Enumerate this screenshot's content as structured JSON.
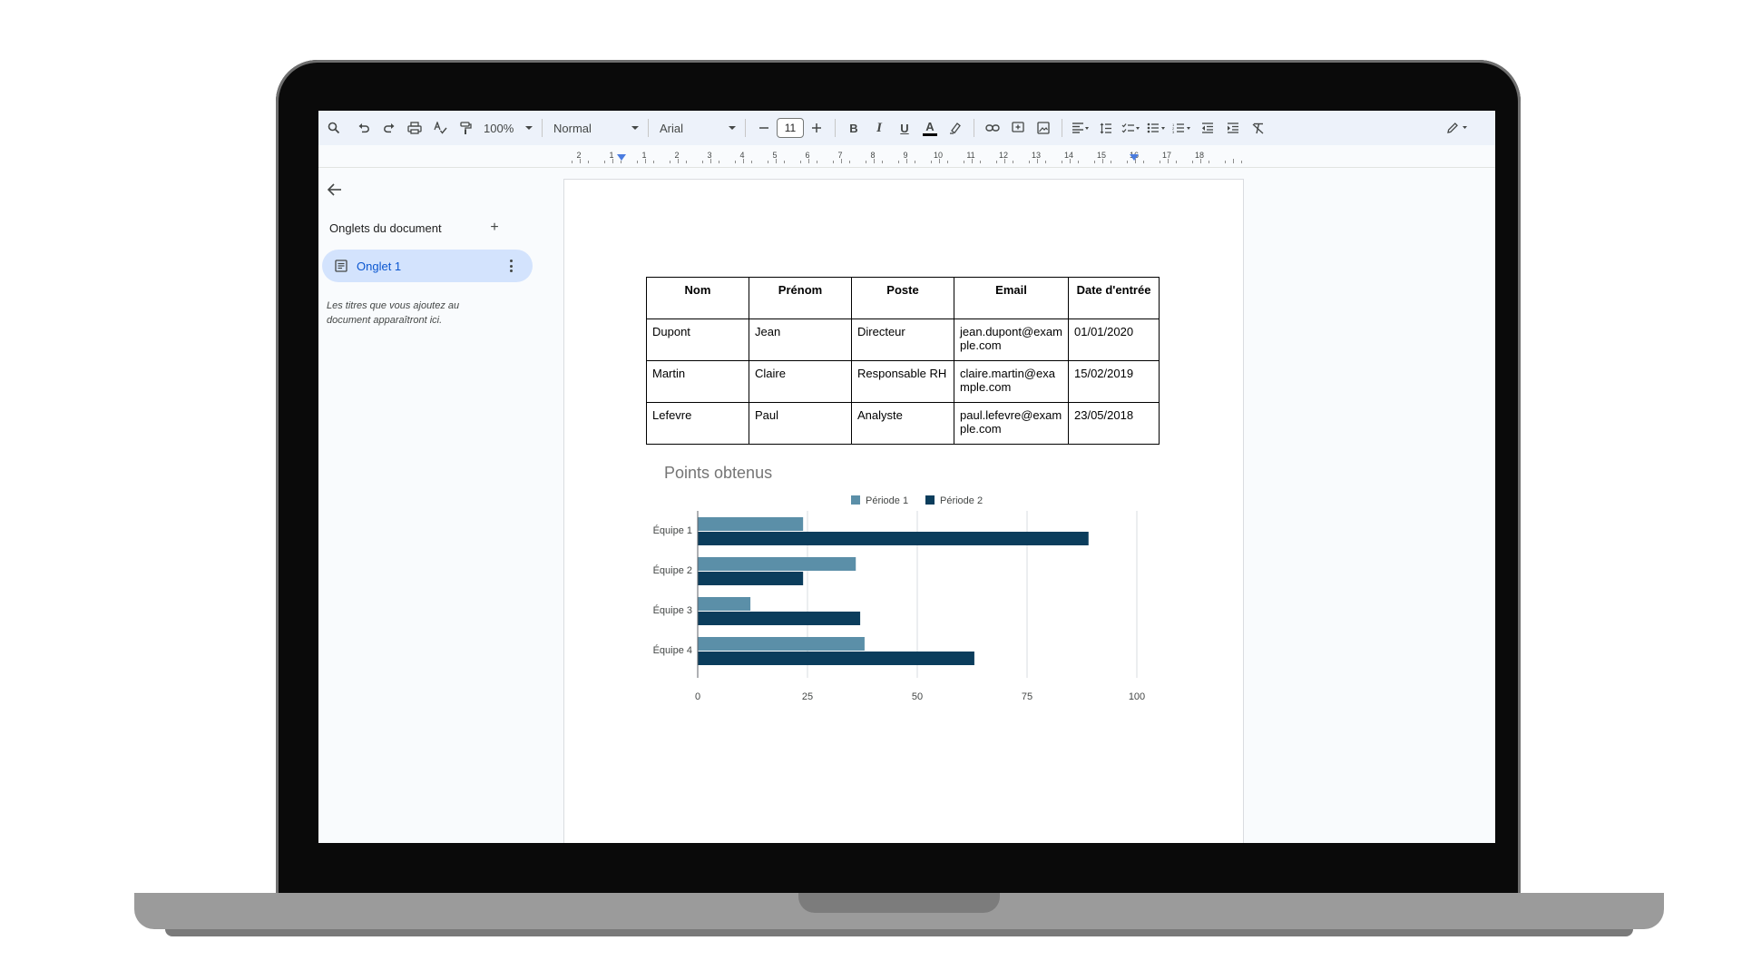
{
  "toolbar": {
    "zoom": "100%",
    "style": "Normal",
    "font": "Arial",
    "font_size": "11",
    "bold": "B",
    "italic": "I",
    "underline": "U",
    "text_color": "A"
  },
  "ruler": {
    "numbers": [
      "2",
      "1",
      "1",
      "2",
      "3",
      "4",
      "5",
      "6",
      "7",
      "8",
      "9",
      "10",
      "11",
      "12",
      "13",
      "14",
      "15",
      "16",
      "17",
      "18"
    ]
  },
  "sidebar": {
    "section_title": "Onglets du document",
    "tab_label": "Onglet 1",
    "hint": "Les titres que vous ajoutez au document apparaîtront ici."
  },
  "table": {
    "headers": [
      "Nom",
      "Prénom",
      "Poste",
      "Email",
      "Date d'entrée"
    ],
    "rows": [
      [
        "Dupont",
        "Jean",
        "Directeur",
        "jean.dupont@example.com",
        "01/01/2020"
      ],
      [
        "Martin",
        "Claire",
        "Responsable RH",
        "claire.martin@example.com",
        "15/02/2019"
      ],
      [
        "Lefevre",
        "Paul",
        "Analyste",
        "paul.lefevre@example.com",
        "23/05/2018"
      ]
    ]
  },
  "chart_data": {
    "type": "bar",
    "orientation": "horizontal",
    "title": "Points obtenus",
    "categories": [
      "Équipe 1",
      "Équipe 2",
      "Équipe 3",
      "Équipe 4"
    ],
    "series": [
      {
        "name": "Période 1",
        "values": [
          24,
          36,
          12,
          38
        ],
        "color": "#5b8fa8"
      },
      {
        "name": "Période 2",
        "values": [
          89,
          24,
          37,
          63
        ],
        "color": "#0b3d5c"
      }
    ],
    "xlim": [
      0,
      100
    ],
    "xticks": [
      0,
      25,
      50,
      75,
      100
    ],
    "grid": true,
    "legend": "top"
  },
  "colors": {
    "toolbar_bg": "#edf2fa",
    "tab_active_bg": "#d3e3fd",
    "tab_active_text": "#0b57d0"
  }
}
